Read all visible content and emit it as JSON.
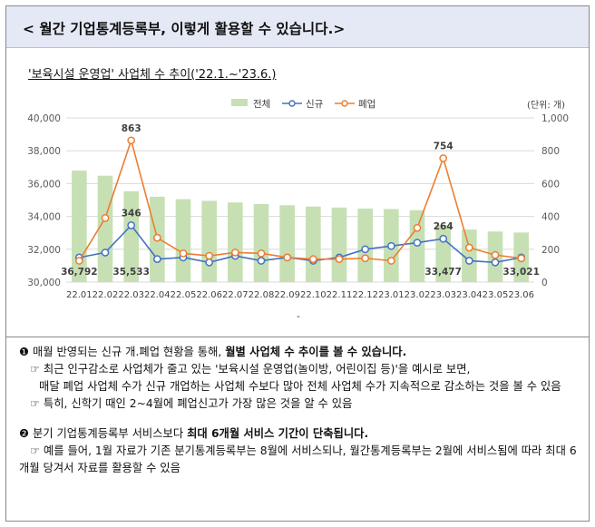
{
  "header": {
    "title": "< 월간 기업통계등록부, 이렇게 활용할 수 있습니다.>"
  },
  "chart_title": "'보육시설 운영업' 사업체 수 추이('22.1.~'23.6.)",
  "chart_data": {
    "type": "bar",
    "unit_label": "(단위: 개)",
    "categories": [
      "22.01",
      "22.02",
      "22.03",
      "22.04",
      "22.05",
      "22.06",
      "22.07",
      "22.08",
      "22.09",
      "22.10",
      "22.11",
      "22.12",
      "23.01",
      "23.02",
      "23.03",
      "23.04",
      "23.05",
      "23.06"
    ],
    "series": [
      {
        "name": "전체",
        "type": "bar",
        "axis": "left",
        "color": "#c6e0b4",
        "values": [
          36792,
          36480,
          35533,
          35200,
          35050,
          34950,
          34850,
          34750,
          34680,
          34600,
          34540,
          34480,
          34450,
          34380,
          33477,
          33200,
          33080,
          33021
        ]
      },
      {
        "name": "신규",
        "type": "line",
        "axis": "right",
        "color": "#4472c4",
        "values": [
          150,
          180,
          346,
          140,
          150,
          120,
          160,
          130,
          150,
          130,
          150,
          200,
          220,
          240,
          264,
          130,
          120,
          150
        ]
      },
      {
        "name": "폐업",
        "type": "line",
        "axis": "right",
        "color": "#ed7d31",
        "values": [
          130,
          390,
          863,
          270,
          175,
          160,
          180,
          175,
          150,
          140,
          140,
          145,
          130,
          330,
          754,
          210,
          165,
          145
        ]
      }
    ],
    "left_axis": {
      "min": 30000,
      "max": 40000,
      "ticks": [
        "30,000",
        "32,000",
        "34,000",
        "36,000",
        "38,000",
        "40,000"
      ]
    },
    "right_axis": {
      "min": 0,
      "max": 1000,
      "ticks": [
        "0",
        "200",
        "400",
        "600",
        "800",
        "1,000"
      ]
    },
    "data_labels": [
      {
        "series": "전체",
        "index": 0,
        "text": "36,792"
      },
      {
        "series": "전체",
        "index": 2,
        "text": "35,533"
      },
      {
        "series": "전체",
        "index": 14,
        "text": "33,477"
      },
      {
        "series": "전체",
        "index": 17,
        "text": "33,021"
      },
      {
        "series": "신규",
        "index": 2,
        "text": "346"
      },
      {
        "series": "신규",
        "index": 14,
        "text": "264"
      },
      {
        "series": "폐업",
        "index": 2,
        "text": "863"
      },
      {
        "series": "폐업",
        "index": 14,
        "text": "754"
      }
    ],
    "legend_position": "top",
    "footnote_mark": "-"
  },
  "notes": {
    "s1_bullet": "❶",
    "s1_lead": " 매월 반영되는 신규 개.폐업 현황을 통해, ",
    "s1_bold": "월별 사업체 수 추이를 볼 수 있습니다.",
    "s1_l1": "☞ 최근 인구감소로 사업체가 줄고 있는 '보육시설 운영업(놀이방, 어린이집 등)'을 예시로 보면,",
    "s1_l2": "매달 폐업 사업체 수가 신규 개업하는 사업체 수보다 많아 전체 사업체 수가 지속적으로 감소하는 것을 볼 수 있음",
    "s1_l3": "☞ 특히, 신학기 때인 2~4월에 폐업신고가 가장 많은 것을 알 수 있음",
    "s2_bullet": "❷",
    "s2_lead": " 분기 기업통계등록부 서비스보다 ",
    "s2_bold": "최대 6개월 서비스 기간이 단축됩니다.",
    "s2_l1": "☞ 예를 들어, 1월 자료가 기존 분기통계등록부는 8월에 서비스되나, 월간통계등록부는 2월에 서비스됨에 따라 최대 6개월 당겨서 자료를 활용할 수 있음"
  }
}
